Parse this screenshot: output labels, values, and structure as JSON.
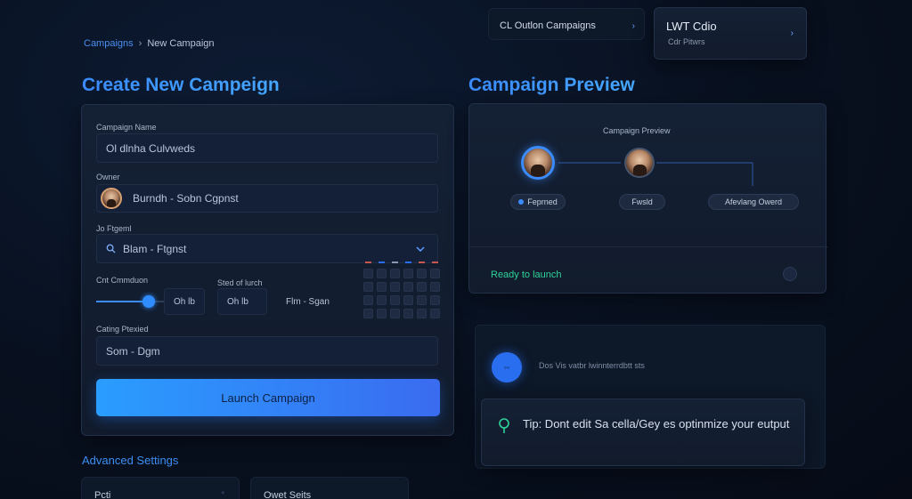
{
  "breadcrumb": {
    "parent": "Campaigns",
    "separator": "›",
    "current": "New Campaign"
  },
  "top_cards": [
    {
      "title": "CL Outlon Campaigns",
      "subtitle": ""
    },
    {
      "title": "LWT Cdio",
      "subtitle": "Cdr Pitwrs"
    }
  ],
  "create": {
    "title": "Create New Campeign",
    "campaign_name_label": "Campaign Name",
    "campaign_name_value": "Ol dlnha Culvweds",
    "owner_label": "Owner",
    "owner_value": "Burndh - Sobn Cgpnst",
    "target_label": "Jo Ftgeml",
    "target_value": "Blam - Ftgnst",
    "duration_label": "Cnt Cmmduon",
    "duration_value": "Oh lb",
    "start_label": "Sted of lurch",
    "start_value": "Oh lb",
    "start_range": "Flm - Sgan",
    "priority_label": "Cating Ptexied",
    "priority_value": "Som - Dgm",
    "launch_button": "Launch Campaign",
    "slider_percent": 77
  },
  "advanced": {
    "title": "Advanced Settings",
    "card1": "Pcti",
    "card2": "Owet Seits"
  },
  "preview": {
    "title": "Campaign Preview",
    "flow_title": "Campaign Preview",
    "nodes": [
      "Feprned",
      "Fwsld",
      "Afevlang Owerd"
    ],
    "ready_label": "Ready to launch",
    "info_text": "Dos Vis vatbr lwinnterrdbtt sts",
    "tip_text": "Tip: Dont edit Sa cella/Gey es optinmize your eutput"
  },
  "colors": {
    "accent": "#3a8cff",
    "button_start": "#2a9dff",
    "button_end": "#3a6bf0",
    "green": "#2fd49a"
  },
  "icons": {
    "search": "search-icon",
    "chevron": "chevron-right-icon",
    "dropdown": "chevron-down-icon",
    "lightbulb": "lightbulb-icon"
  }
}
